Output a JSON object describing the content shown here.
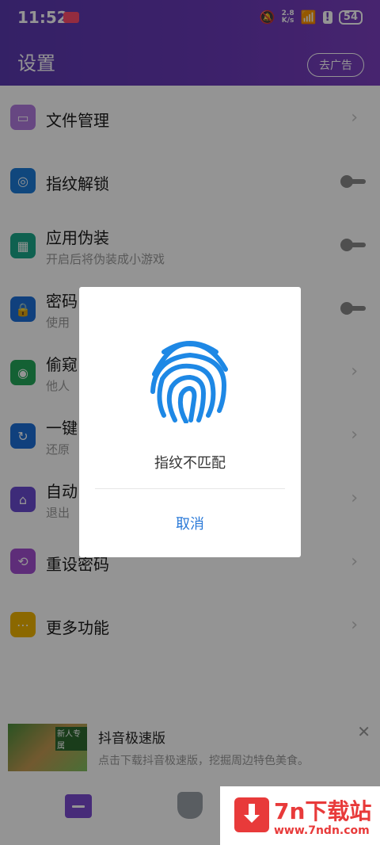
{
  "status": {
    "time": "11:52",
    "speed_value": "2.8",
    "speed_unit": "K/s",
    "battery": "54"
  },
  "header": {
    "title": "设置",
    "no_ads_label": "去广告"
  },
  "settings": {
    "file_manage": "文件管理",
    "fingerprint": "指纹解锁",
    "disguise": "应用伪装",
    "disguise_sub": "开启后将伪装成小游戏",
    "password": "密码",
    "password_sub": "使用",
    "peek": "偷窥",
    "peek_sub": "他人",
    "one_key": "一键",
    "one_key_sub": "还原",
    "auto": "自动",
    "auto_sub": "退出",
    "reset_pw": "重设密码",
    "more": "更多功能"
  },
  "ad": {
    "title": "抖音极速版",
    "subtitle": "点击下载抖音极速版，挖掘周边特色美食。",
    "image_text": "新人专属"
  },
  "dialog": {
    "message": "指纹不匹配",
    "cancel": "取消"
  },
  "watermark": {
    "title": "7n下载站",
    "url": "www.7ndn.com"
  },
  "colors": {
    "header": "#6a3ab8",
    "accent": "#2b7ad8",
    "fingerprint": "#1e88e5"
  }
}
